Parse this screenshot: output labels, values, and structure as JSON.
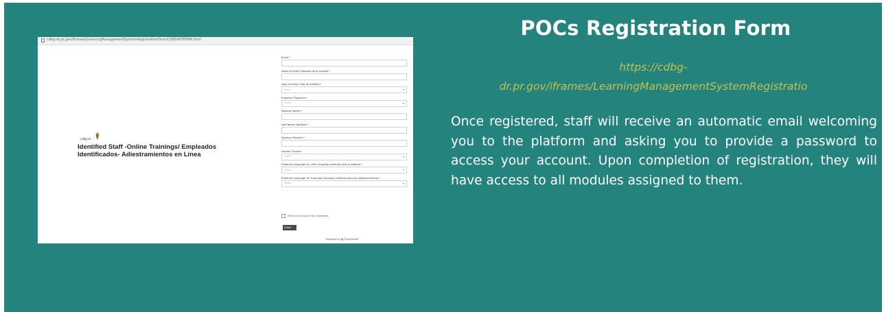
{
  "slide": {
    "title": "POCs Registration Form",
    "link_line1": "https://cdbg-",
    "link_line2": "dr.pr.gov/iframes/LearningManagementSystemRegistratio",
    "body": "Once registered, staff will receive an automatic email welcoming you to the platform and asking you to provide a password to access your account. Upon completion of registration, they will have access to all modules assigned to them."
  },
  "screenshot": {
    "url": "cdbg-dr.pr.gov/iframes/LearningManagementSystemRegistrationForm/CDBGMTRFRM.html",
    "brand": "cdbg-dr",
    "heading": "Identified Staff -Online Trainings/ Empleados Identificados- Adiestramientos en Linea",
    "fields": [
      {
        "label": "Email *",
        "placeholder": "",
        "dropdown": false
      },
      {
        "label": "Name of entity/ Nombre de la entidad *",
        "placeholder": "",
        "dropdown": false
      },
      {
        "label": "Type of entity/ Tipo de entidad *",
        "placeholder": "Select",
        "dropdown": true
      },
      {
        "label": "Program/ Programa *",
        "placeholder": "Select",
        "dropdown": true
      },
      {
        "label": "Nombre/ Name *",
        "placeholder": "",
        "dropdown": false
      },
      {
        "label": "Last Name/ Apellido *",
        "placeholder": "",
        "dropdown": false
      },
      {
        "label": "Position/ Posición *",
        "placeholder": "",
        "dropdown": false
      },
      {
        "label": "Gender/ Genero",
        "placeholder": "Select",
        "dropdown": true
      },
      {
        "label": "Preferred Language for LMS/ Lenguaje preferido para el sistema *",
        "placeholder": "Select",
        "dropdown": true
      },
      {
        "label": "Preferred Language for Trainings/ Lenguaje preferido para los adiestramientos *",
        "placeholder": "Select",
        "dropdown": true
      }
    ],
    "agree_label": "Send me a copy of my responses",
    "submit_label": "Submit",
    "powered_by": "Powered by ▦ Smartsheet"
  }
}
